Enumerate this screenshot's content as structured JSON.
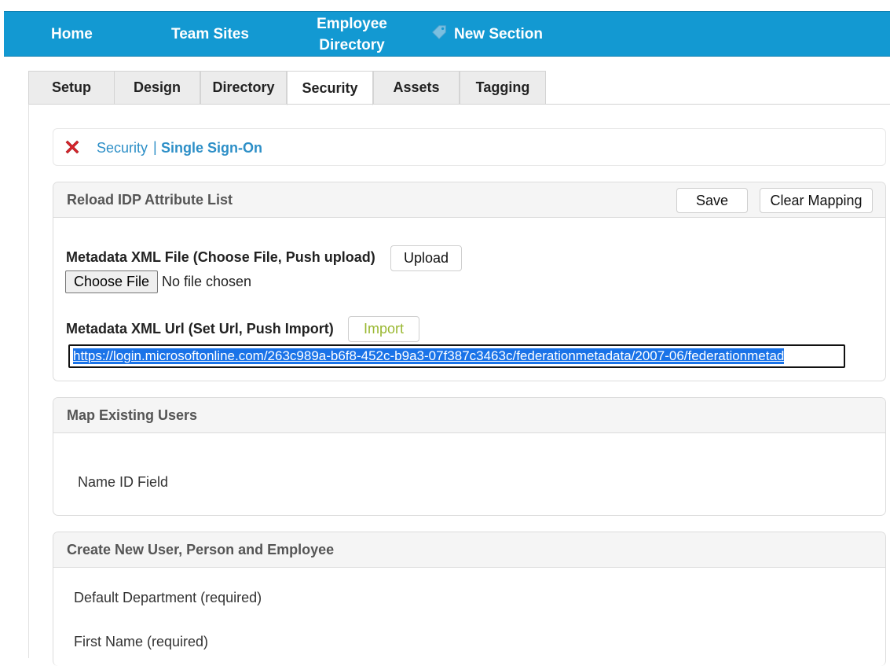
{
  "nav": {
    "home": "Home",
    "team_sites": "Team Sites",
    "employee_directory": "Employee Directory",
    "new_section": "New Section"
  },
  "tabs": [
    {
      "label": "Setup"
    },
    {
      "label": "Design"
    },
    {
      "label": "Directory"
    },
    {
      "label": "Security",
      "active": true
    },
    {
      "label": "Assets"
    },
    {
      "label": "Tagging"
    }
  ],
  "breadcrumb": {
    "parent": "Security",
    "separator": "|",
    "current": "Single Sign-On"
  },
  "reload_panel": {
    "title": "Reload IDP Attribute List",
    "save_label": "Save",
    "clear_mapping_label": "Clear Mapping",
    "metadata_file_label": "Metadata XML File (Choose File, Push upload)",
    "upload_label": "Upload",
    "choose_file_label": "Choose File",
    "no_file_text": "No file chosen",
    "metadata_url_label": "Metadata XML Url (Set Url, Push Import)",
    "import_label": "Import",
    "url_value": "https://login.microsoftonline.com/263c989a-b6f8-452c-b9a3-07f387c3463c/federationmetadata/2007-06/federationmetad"
  },
  "map_panel": {
    "title": "Map Existing Users",
    "name_id_label": "Name ID Field"
  },
  "create_panel": {
    "title": "Create New User, Person and Employee",
    "default_department_label": "Default Department (required)",
    "first_name_label": "First Name (required)"
  },
  "colors": {
    "nav_bg": "#1399d2",
    "link": "#2d8fc7",
    "import_text": "#9ab832",
    "close_icon": "#d9232a"
  }
}
